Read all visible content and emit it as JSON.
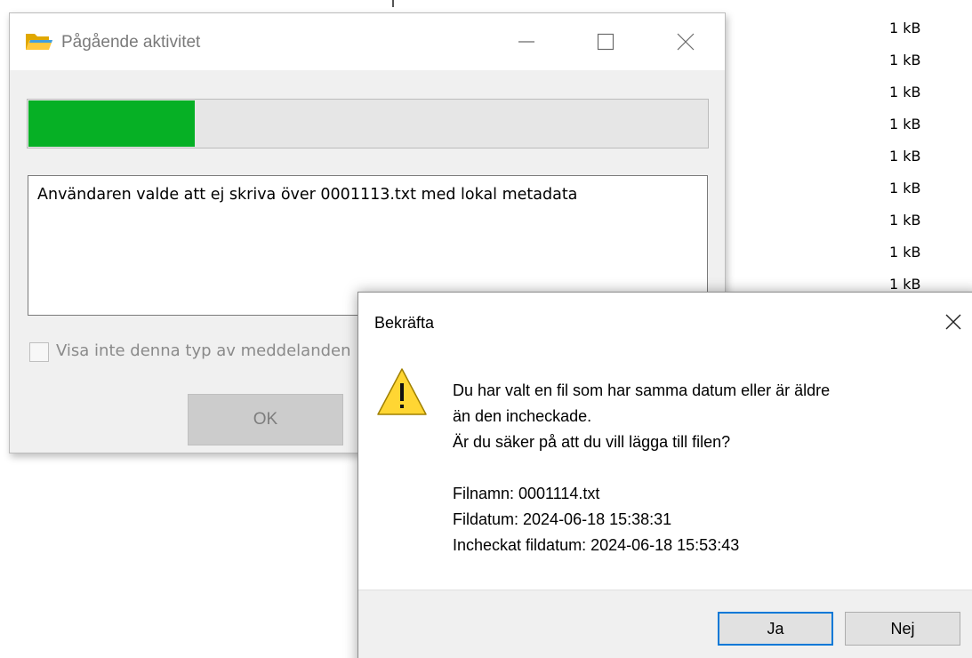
{
  "background": {
    "sizes": [
      "1 kB",
      "1 kB",
      "1 kB",
      "1 kB",
      "1 kB",
      "1 kB",
      "1 kB",
      "1 kB",
      "1 kB"
    ]
  },
  "progress_window": {
    "title": "Pågående aktivitet",
    "title_icon": "folder-icon",
    "progress_fraction": 0.245,
    "progress_color": "#06b025",
    "message": "Användaren valde att ej skriva över 0001113.txt med lokal metadata",
    "checkbox_label": "Visa inte denna typ av meddelanden",
    "checkbox_checked": false,
    "ok_label": "OK"
  },
  "confirm_dialog": {
    "title": "Bekräfta",
    "icon": "warning-icon",
    "message_lines": [
      "Du har valt en fil som har samma datum eller är äldre",
      "än den incheckade.",
      "Är du säker på att du vill lägga till filen?"
    ],
    "details": [
      "Filnamn: 0001114.txt",
      "Fildatum: 2024-06-18 15:38:31",
      "Incheckat fildatum: 2024-06-18 15:53:43"
    ],
    "yes_label": "Ja",
    "no_label": "Nej",
    "accent_color": "#0078d7"
  }
}
